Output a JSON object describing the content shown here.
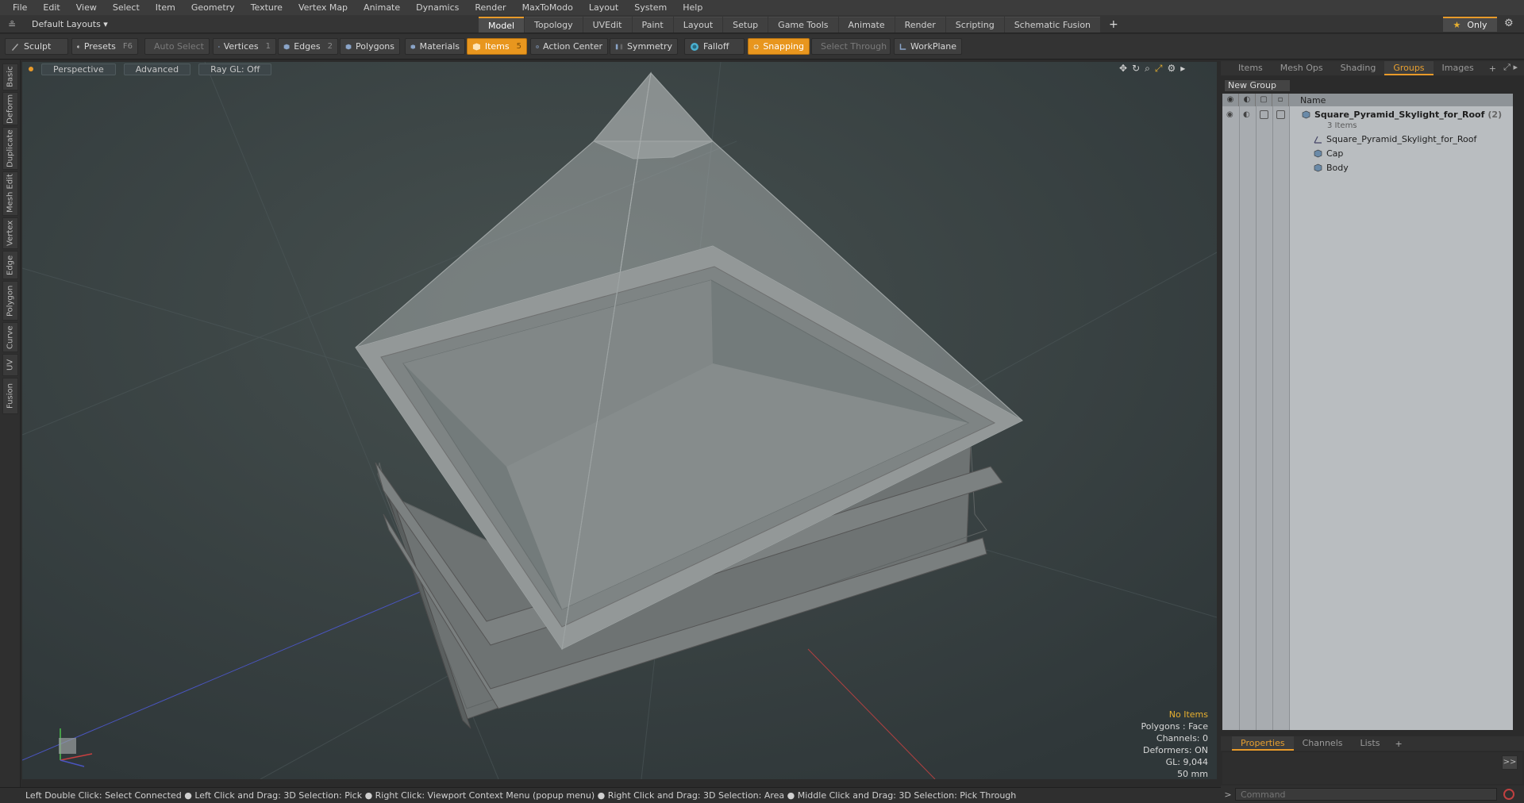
{
  "menu": [
    "File",
    "Edit",
    "View",
    "Select",
    "Item",
    "Geometry",
    "Texture",
    "Vertex Map",
    "Animate",
    "Dynamics",
    "Render",
    "MaxToModo",
    "Layout",
    "System",
    "Help"
  ],
  "layout": {
    "label": "Default Layouts ▾"
  },
  "main_tabs": [
    {
      "label": "Model",
      "active": true
    },
    {
      "label": "Topology"
    },
    {
      "label": "UVEdit"
    },
    {
      "label": "Paint"
    },
    {
      "label": "Layout"
    },
    {
      "label": "Setup"
    },
    {
      "label": "Game Tools"
    },
    {
      "label": "Animate"
    },
    {
      "label": "Render"
    },
    {
      "label": "Scripting"
    },
    {
      "label": "Schematic Fusion"
    }
  ],
  "add_tab": "+",
  "only_label": "Only",
  "toolbar": {
    "sculpt": "Sculpt",
    "presets": "Presets",
    "presets_key": "F6",
    "auto_select": "Auto Select",
    "vertices": "Vertices",
    "vertices_count": "1",
    "edges": "Edges",
    "edges_count": "2",
    "polygons": "Polygons",
    "materials": "Materials",
    "items": "Items",
    "items_count": "5",
    "action_center": "Action Center",
    "symmetry": "Symmetry",
    "falloff": "Falloff",
    "snapping": "Snapping",
    "select_through": "Select Through",
    "workplane": "WorkPlane"
  },
  "left_tabs": [
    "Basic",
    "Deform",
    "Duplicate",
    "Mesh Edit",
    "Vertex",
    "Edge",
    "Polygon",
    "Curve",
    "UV",
    "Fusion"
  ],
  "viewport": {
    "perspective": "Perspective",
    "advanced": "Advanced",
    "raygl": "Ray GL: Off"
  },
  "stats": {
    "no_items": "No Items",
    "polygons": "Polygons : Face",
    "channels": "Channels: 0",
    "deformers": "Deformers: ON",
    "gl": "GL: 9,044",
    "mm": "50 mm"
  },
  "status_text": "Left Double Click: Select Connected ● Left Click and Drag: 3D Selection: Pick ● Right Click: Viewport Context Menu (popup menu) ● Right Click and Drag: 3D Selection: Area ● Middle Click and Drag: 3D Selection: Pick Through",
  "right_tabs": [
    {
      "label": "Items"
    },
    {
      "label": "Mesh Ops"
    },
    {
      "label": "Shading"
    },
    {
      "label": "Groups",
      "active": true
    },
    {
      "label": "Images"
    }
  ],
  "new_group": "New Group",
  "tree": {
    "name_header": "Name",
    "group": {
      "name": "Square_Pyramid_Skylight_for_Roof",
      "count": "(2)",
      "sub": "3 Items"
    },
    "children": [
      "Square_Pyramid_Skylight_for_Roof",
      "Cap",
      "Body"
    ]
  },
  "bottom_tabs": [
    {
      "label": "Properties",
      "active": true
    },
    {
      "label": "Channels"
    },
    {
      "label": "Lists"
    }
  ],
  "command_placeholder": "Command",
  "colors": {
    "accent": "#e89a2a",
    "viewport_bg": "#364043"
  }
}
